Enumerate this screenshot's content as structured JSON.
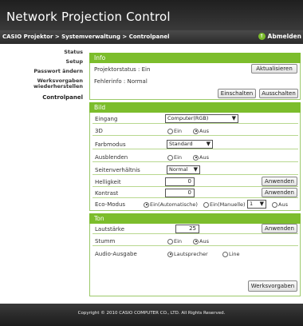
{
  "header": {
    "title": "Network Projection Control"
  },
  "crumb": {
    "path": "CASIO Projektor > Systemverwaltung > Controlpanel",
    "logout": "Abmelden"
  },
  "sidebar": {
    "items": [
      {
        "label": "Status"
      },
      {
        "label": "Setup"
      },
      {
        "label": "Passwort ändern"
      },
      {
        "label": "Werksvorgaben wiederherstellen"
      },
      {
        "label": "Controlpanel"
      }
    ]
  },
  "info": {
    "heading": "Info",
    "status": "Projektorstatus : Ein",
    "error": "Fehlerinfo : Normal",
    "refresh": "Aktualisieren",
    "on": "Einschalten",
    "off": "Ausschalten"
  },
  "bild": {
    "heading": "Bild",
    "eingang_label": "Eingang",
    "eingang_value": "Computer(RGB)",
    "threed_label": "3D",
    "opt_ein": "Ein",
    "opt_aus": "Aus",
    "farbmodus_label": "Farbmodus",
    "farbmodus_value": "Standard",
    "ausblenden_label": "Ausblenden",
    "seiten_label": "Seitenverhältnis",
    "seiten_value": "Normal",
    "helligkeit_label": "Helligkeit",
    "helligkeit_value": "0",
    "kontrast_label": "Kontrast",
    "kontrast_value": "0",
    "apply": "Anwenden",
    "eco_label": "Eco-Modus",
    "eco_auto": "Ein(Automatische)",
    "eco_manual": "Ein(Manuelle)",
    "eco_level": "1",
    "eco_aus": "Aus"
  },
  "ton": {
    "heading": "Ton",
    "laut_label": "Lautstärke",
    "laut_value": "25",
    "apply": "Anwenden",
    "stumm_label": "Stumm",
    "opt_ein": "Ein",
    "opt_aus": "Aus",
    "audio_label": "Audio-Ausgabe",
    "audio_speaker": "Lautsprecher",
    "audio_line": "Line",
    "factory": "Werksvorgaben"
  },
  "footer": {
    "copyright": "Copyright © 2010 CASIO COMPUTER CO., LTD. All Rights Reserved."
  },
  "colors": {
    "accent": "#7cbd2c",
    "header": "#2b2b2b"
  }
}
